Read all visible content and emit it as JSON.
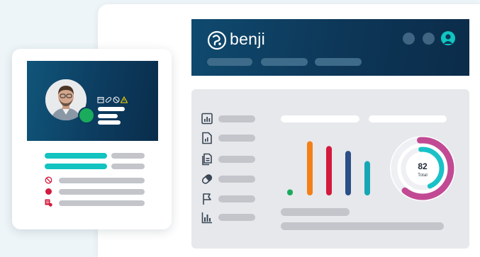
{
  "app": {
    "logo_text": "benji",
    "brand_color": "#0d3657",
    "accent_color": "#12c3c0"
  },
  "header": {
    "icons": [
      "circle-button-icon",
      "circle-button-icon",
      "user-avatar-icon"
    ]
  },
  "sidebar": {
    "icons": [
      "bar-chart-icon",
      "report-icon",
      "documents-icon",
      "pill-icon",
      "flag-icon",
      "analytics-icon"
    ]
  },
  "chart_data": [
    {
      "type": "bar",
      "series": [
        {
          "values": [
            1,
            9,
            8.2,
            7.4,
            5.7
          ]
        }
      ],
      "colors": [
        "#1aab5c",
        "#f57f17",
        "#d3193d",
        "#2b4f86",
        "#16a7b5"
      ],
      "ylim": [
        0,
        10
      ],
      "grid": false
    },
    {
      "type": "pie",
      "center_value": "82",
      "center_label": "Total",
      "rings": [
        {
          "value": 0.62,
          "color": "#c24a94"
        },
        {
          "value": 0.45,
          "color": "#19c2c8"
        }
      ]
    }
  ],
  "profile": {
    "status_color": "#1aab5c",
    "badge_icons": [
      "calendar-icon",
      "pill-icon",
      "block-icon",
      "warning-icon"
    ],
    "rows": [
      "block-icon",
      "dot-icon",
      "alert-icon"
    ]
  }
}
